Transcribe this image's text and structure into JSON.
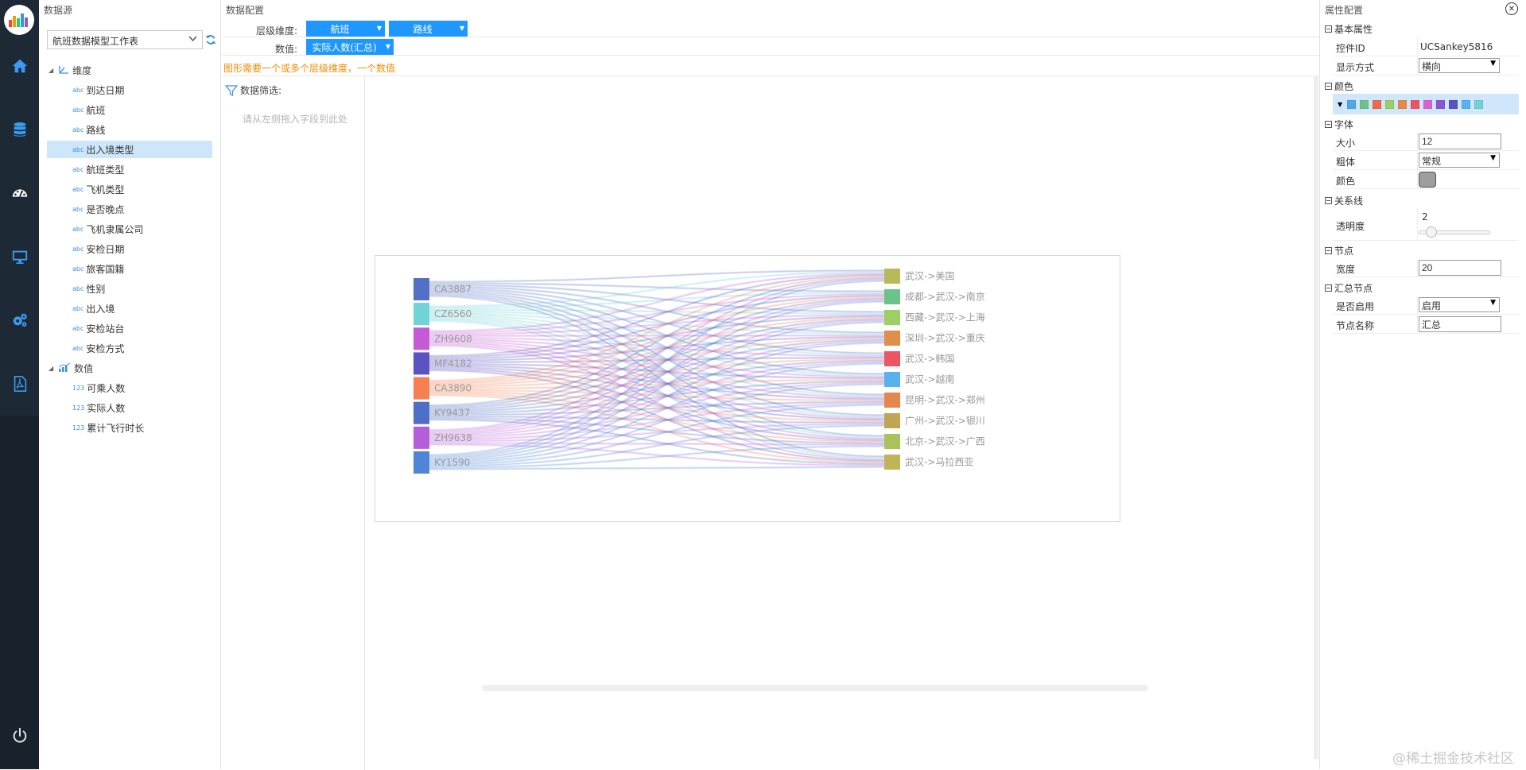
{
  "datasource": {
    "title": "数据源",
    "model_select": "航班数据模型工作表",
    "dimension_group": "维度",
    "dimensions": [
      {
        "tag": "abc",
        "label": "到达日期"
      },
      {
        "tag": "abc",
        "label": "航班"
      },
      {
        "tag": "abc",
        "label": "路线"
      },
      {
        "tag": "abc",
        "label": "出入境类型"
      },
      {
        "tag": "abc",
        "label": "航班类型"
      },
      {
        "tag": "abc",
        "label": "飞机类型"
      },
      {
        "tag": "abc",
        "label": "是否晚点"
      },
      {
        "tag": "abc",
        "label": "飞机隶属公司"
      },
      {
        "tag": "abc",
        "label": "安检日期"
      },
      {
        "tag": "abc",
        "label": "旅客国籍"
      },
      {
        "tag": "abc",
        "label": "性别"
      },
      {
        "tag": "abc",
        "label": "出入境"
      },
      {
        "tag": "abc",
        "label": "安检站台"
      },
      {
        "tag": "abc",
        "label": "安检方式"
      }
    ],
    "selected_dimension": "出入境类型",
    "value_group": "数值",
    "values": [
      {
        "tag": "123",
        "label": "可乘人数"
      },
      {
        "tag": "123",
        "label": "实际人数"
      },
      {
        "tag": "123",
        "label": "累计飞行时长"
      }
    ]
  },
  "dataconfig": {
    "title": "数据配置",
    "level_label": "层级维度:",
    "level_items": [
      "航班",
      "路线"
    ],
    "value_label": "数值:",
    "value_item": "实际人数(汇总)",
    "warning": "图形需要一个或多个层级维度，一个数值",
    "filter_label": "数据筛选:",
    "filter_hint": "请从左侧拖入字段到此处"
  },
  "chart_data": {
    "type": "sankey",
    "title": "",
    "left_nodes": [
      {
        "name": "CA3887",
        "color": "#5470c6"
      },
      {
        "name": "CZ6560",
        "color": "#6fd3d8"
      },
      {
        "name": "ZH9608",
        "color": "#c45ad6"
      },
      {
        "name": "MF4182",
        "color": "#5b54c0"
      },
      {
        "name": "CA3890",
        "color": "#f58051"
      },
      {
        "name": "KY9437",
        "color": "#4e6fc6"
      },
      {
        "name": "ZH9638",
        "color": "#b45fd9"
      },
      {
        "name": "KY1590",
        "color": "#4f85d6"
      }
    ],
    "right_nodes": [
      {
        "name": "武汉->美国",
        "color": "#b9b85a"
      },
      {
        "name": "成都->武汉->南京",
        "color": "#6cc38a"
      },
      {
        "name": "西藏->武汉->上海",
        "color": "#9ecf66"
      },
      {
        "name": "深圳->武汉->重庆",
        "color": "#df8e4c"
      },
      {
        "name": "武汉->韩国",
        "color": "#ee5563"
      },
      {
        "name": "武汉->越南",
        "color": "#58b2ee"
      },
      {
        "name": "昆明->武汉->郑州",
        "color": "#e5874d"
      },
      {
        "name": "广州->武汉->银川",
        "color": "#bfa654"
      },
      {
        "name": "北京->武汉->广西",
        "color": "#aac25c"
      },
      {
        "name": "武汉->马拉西亚",
        "color": "#bfb45a"
      }
    ]
  },
  "properties": {
    "title": "属性配置",
    "close": "✕",
    "basic_section": "基本属性",
    "control_id_label": "控件ID",
    "control_id_value": "UCSankey5816",
    "display_label": "显示方式",
    "display_value": "横向",
    "color_section": "颜色",
    "palette": [
      "#4fa8e8",
      "#6cc38a",
      "#ee6a4a",
      "#9ecf66",
      "#e58a4a",
      "#ee5563",
      "#d765d0",
      "#8a55d8",
      "#5b54c0",
      "#58b2ee",
      "#6fd3d8"
    ],
    "font_section": "字体",
    "size_label": "大小",
    "size_value": "12",
    "bold_label": "粗体",
    "bold_value": "常规",
    "fontcolor_label": "颜色",
    "fontcolor_value": "#9e9e9e",
    "link_section": "关系线",
    "opacity_label": "透明度",
    "opacity_value": "2",
    "node_section": "节点",
    "width_label": "宽度",
    "width_value": "20",
    "summary_section": "汇总节点",
    "enable_label": "是否启用",
    "enable_value": "启用",
    "nodename_label": "节点名称",
    "nodename_value": "汇总"
  },
  "watermark": "@稀土掘金技术社区"
}
